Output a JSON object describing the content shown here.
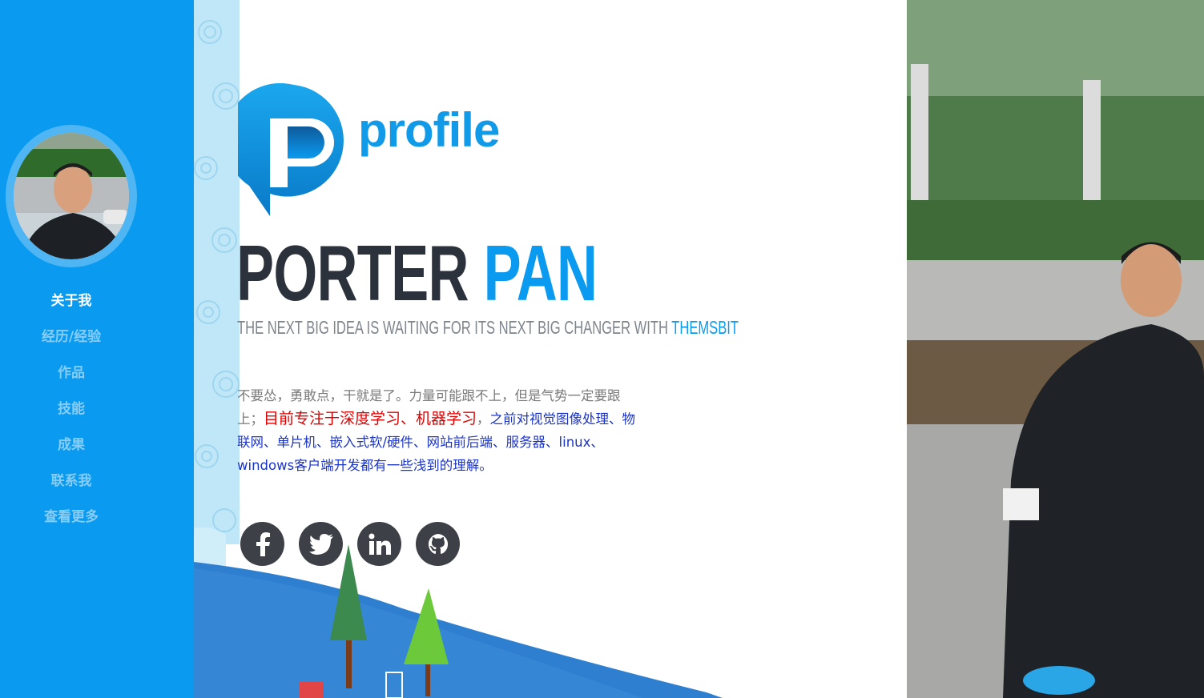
{
  "sidebar": {
    "nav": [
      {
        "label": "关于我",
        "active": true
      },
      {
        "label": "经历/经验",
        "active": false
      },
      {
        "label": "作品",
        "active": false
      },
      {
        "label": "技能",
        "active": false
      },
      {
        "label": "成果",
        "active": false
      },
      {
        "label": "联系我",
        "active": false
      },
      {
        "label": "查看更多",
        "active": false
      }
    ]
  },
  "main": {
    "logo_text": "profile",
    "headline_first": "PORTER",
    "headline_last": "PAN",
    "tagline": "THE NEXT BIG IDEA IS WAITING FOR ITS NEXT BIG CHANGER WITH",
    "tagline_accent": "THEMSBIT",
    "bio_plain": "不要怂，勇敢点，干就是了。力量可能跟不上，但是气势一定要跟上；",
    "bio_highlight": "目前专注于深度学习、机器学习",
    "bio_sep": "，",
    "bio_blue": "之前对视觉图像处理、物联网、单片机、嵌入式软/硬件、网站前后端、服务器、linux、windows客户端开发都有一些浅到的理解。"
  },
  "social": [
    {
      "icon": "facebook-icon"
    },
    {
      "icon": "twitter-icon"
    },
    {
      "icon": "linkedin-icon"
    },
    {
      "icon": "github-icon"
    }
  ],
  "colors": {
    "sidebar": "#0a9af0",
    "accent": "#0a9af0",
    "headline_dark": "#2c323b",
    "bio_red": "#e00000",
    "bio_blue": "#1b34c8",
    "social_bg": "#3d4147"
  }
}
